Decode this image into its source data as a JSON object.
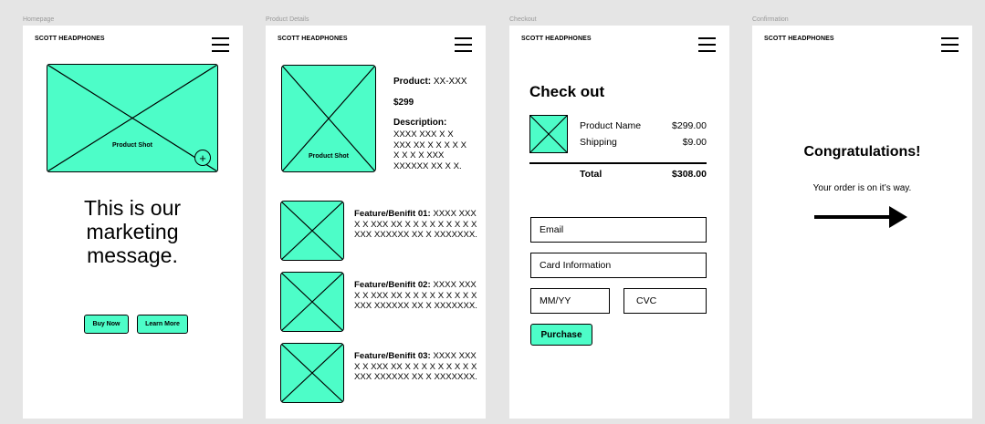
{
  "brand": "SCOTT HEADPHONES",
  "homepage": {
    "frame_label": "Homepage",
    "hero_label": "Product Shot",
    "marketing_message": "This is our marketing message.",
    "buttons": {
      "buy_now": "Buy Now",
      "learn_more": "Learn More"
    }
  },
  "product_details": {
    "frame_label": "Product Details",
    "image_label": "Product Shot",
    "product_label": "Product:",
    "product_value": "XX-XXX",
    "price": "$299",
    "description_label": "Description:",
    "description_text": "XXXX XXX X X XXX XX X X X X X X X X X XXX XXXXXX XX X X.",
    "features": [
      {
        "label": "Feature/Benifit 01:",
        "text": "XXXX XXX X X XXX XX X X X X X X X X X XXX XXXXXX XX X XXXXXXX."
      },
      {
        "label": "Feature/Benifit 02:",
        "text": "XXXX XXX X X XXX XX X X X X X X X X X XXX XXXXXX XX X XXXXXXX."
      },
      {
        "label": "Feature/Benifit 03:",
        "text": "XXXX XXX X X XXX XX X X X X X X X X X XXX XXXXXX XX X XXXXXXX."
      }
    ]
  },
  "checkout": {
    "frame_label": "Checkout",
    "title": "Check out",
    "items": [
      {
        "name": "Product Name",
        "amount": "$299.00"
      },
      {
        "name": "Shipping",
        "amount": "$9.00"
      }
    ],
    "total_label": "Total",
    "total_value": "$308.00",
    "fields": {
      "email": "Email",
      "card": "Card Information",
      "mmyy": "MM/YY",
      "cvc": "CVC"
    },
    "purchase_label": "Purchase"
  },
  "confirmation": {
    "frame_label": "Confirmation",
    "heading": "Congratulations!",
    "message": "Your order is on it’s way."
  },
  "colors": {
    "placeholder_fill": "#4dfdc8",
    "canvas_bg": "#e5e5e5",
    "frame_bg": "#ffffff"
  },
  "icons": [
    "menu-icon",
    "zoom-in-icon",
    "arrow-right-icon"
  ]
}
